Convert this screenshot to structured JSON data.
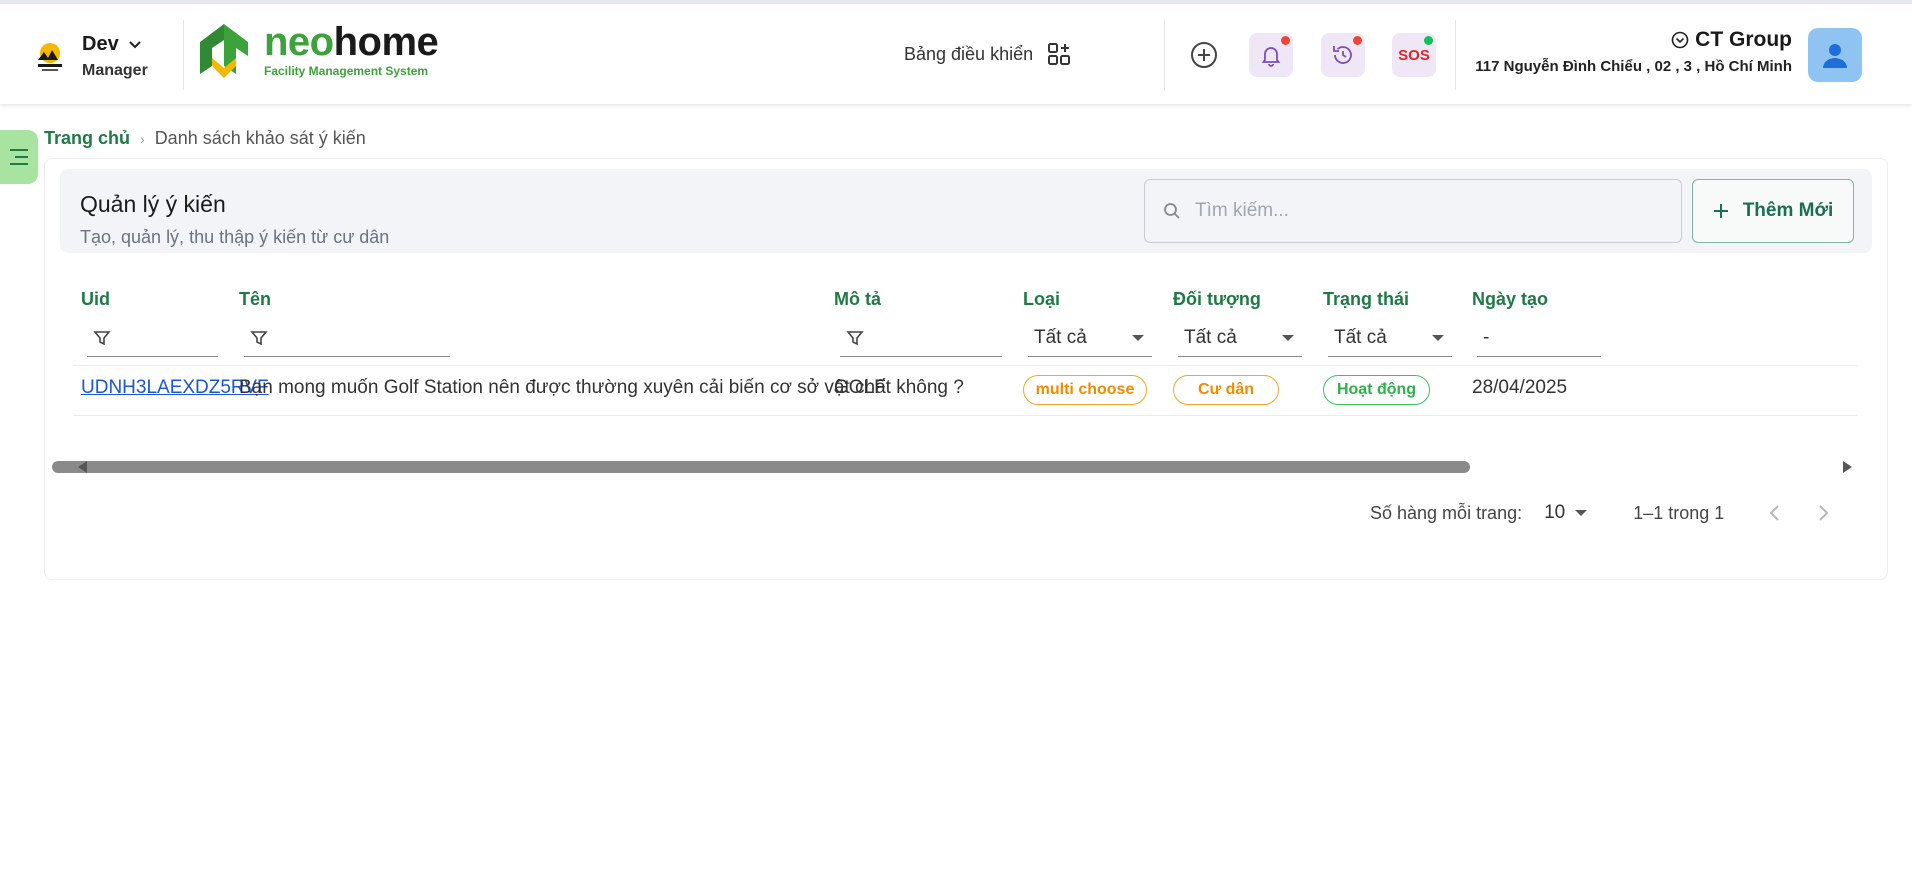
{
  "header": {
    "user": {
      "name": "Dev",
      "role": "Manager"
    },
    "brand": {
      "name_part1": "neo",
      "name_part2": "home",
      "subtitle": "Facility Management System"
    },
    "dashboard_label": "Bảng điều khiển",
    "company": {
      "name": "CT Group",
      "address": "117 Nguyễn Đình Chiểu , 02 , 3 , Hồ Chí Minh"
    },
    "colors": {
      "brand_green": "#3ba33a",
      "notif_dot_red": "#f04438",
      "sos_dot_green": "#12c05a",
      "sos_text": "#e02424"
    }
  },
  "breadcrumb": {
    "home": "Trang chủ",
    "current": "Danh sách khảo sát ý kiến"
  },
  "card": {
    "title": "Quản lý ý kiến",
    "subtitle": "Tạo, quản lý, thu thập ý kiến từ cư dân",
    "search_placeholder": "Tìm kiếm...",
    "add_button": "Thêm Mới"
  },
  "table": {
    "columns": {
      "uid": "Uid",
      "name": "Tên",
      "description": "Mô tả",
      "type": "Loại",
      "audience": "Đối tượng",
      "status": "Trạng thái",
      "created": "Ngày tạo"
    },
    "filters": {
      "type": "Tất cả",
      "audience": "Tất cả",
      "status": "Tất cả",
      "created": "-"
    },
    "rows": [
      {
        "uid": "UDNH3LAEXDZ5RVF",
        "name": "Bạn mong muốn Golf Station nên được thường xuyên cải biến cơ sở vật chất không ?",
        "description": "GOLF",
        "type": "multi choose",
        "audience": "Cư dân",
        "status": "Hoạt động",
        "created": "28/04/2025"
      }
    ]
  },
  "pagination": {
    "rows_per_page_label": "Số hàng mỗi trang:",
    "rows_per_page": "10",
    "range": "1–1 trong 1"
  }
}
